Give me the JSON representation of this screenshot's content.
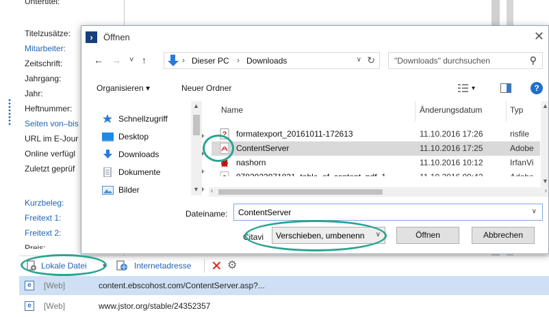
{
  "form": {
    "top_cut_label": "Untertitel:",
    "labels": [
      {
        "text": "Titelzusätze:",
        "link": false
      },
      {
        "text": "Mitarbeiter:",
        "link": true
      },
      {
        "text": "Zeitschrift:",
        "link": false
      },
      {
        "text": "Jahrgang:",
        "link": false
      },
      {
        "text": "Jahr:",
        "link": false
      },
      {
        "text": "Heftnummer:",
        "link": false
      },
      {
        "text": "Seiten von–bis",
        "link": true
      },
      {
        "text": "URL im E-Jour",
        "link": false
      },
      {
        "text": "Online verfügl",
        "link": false
      },
      {
        "text": "Zuletzt geprüf",
        "link": false
      },
      {
        "text": "Kurzbeleg:",
        "link": true
      },
      {
        "text": "Freitext 1:",
        "link": true
      },
      {
        "text": "Freitext 2:",
        "link": true
      },
      {
        "text": "Preis:",
        "link": false
      }
    ]
  },
  "attachments": {
    "local_file_label": "Lokale Datei",
    "web_address_label": "Internetadresse",
    "rows": [
      {
        "kind": "[Web]",
        "address": "content.ebscohost.com/ContentServer.asp?..."
      },
      {
        "kind": "[Web]",
        "address": "www.jstor.org/stable/24352357"
      }
    ]
  },
  "dialog": {
    "logo_letter": "›",
    "title": "Öffnen",
    "close": "✕",
    "nav": {
      "back": "←",
      "forward": "→",
      "recent": "˅",
      "up": "↑"
    },
    "breadcrumb": [
      "Dieser PC",
      "Downloads"
    ],
    "breadcrumb_sep": "›",
    "search_placeholder": "\"Downloads\" durchsuchen",
    "organize_label": "Organisieren ▾",
    "new_folder_label": "Neuer Ordner",
    "help_label": "?",
    "tree": [
      {
        "label": "Schnellzugriff",
        "icon": "star-icon",
        "pinned": false
      },
      {
        "label": "Desktop",
        "icon": "desktop-icon",
        "pinned": true
      },
      {
        "label": "Downloads",
        "icon": "download-icon",
        "pinned": true
      },
      {
        "label": "Dokumente",
        "icon": "documents-icon",
        "pinned": true
      },
      {
        "label": "Bilder",
        "icon": "pictures-icon",
        "pinned": true
      }
    ],
    "pin_glyph": "📌",
    "columns": {
      "name": "Name",
      "date": "Änderungsdatum",
      "type": "Typ"
    },
    "files": [
      {
        "name": "formatexport_20161011-172613",
        "date": "11.10.2016 17:26",
        "type": "risfile",
        "icon": "ris-file-icon",
        "selected": false
      },
      {
        "name": "ContentServer",
        "date": "11.10.2016 17:25",
        "type": "Adobe",
        "icon": "pdf-file-icon",
        "selected": true
      },
      {
        "name": "nashorn",
        "date": "11.10.2016 10:12",
        "type": "IrfanVi",
        "icon": "irfanview-file-icon",
        "selected": false
      },
      {
        "name": "9783923971831_table_of_content_pdf_1",
        "date": "11.10.2016 09:42",
        "type": "Adobe",
        "icon": "pdf-file-icon",
        "selected": false
      }
    ],
    "filename_label": "Dateiname:",
    "filename_value": "ContentServer",
    "citavi_label": "Citavi",
    "action_value": "Verschieben, umbenenn",
    "open_button": "Öffnen",
    "cancel_button": "Abbrechen"
  },
  "colors": {
    "highlight": "#27a58f",
    "link": "#1f63b5",
    "accent": "#1f6fcf"
  }
}
